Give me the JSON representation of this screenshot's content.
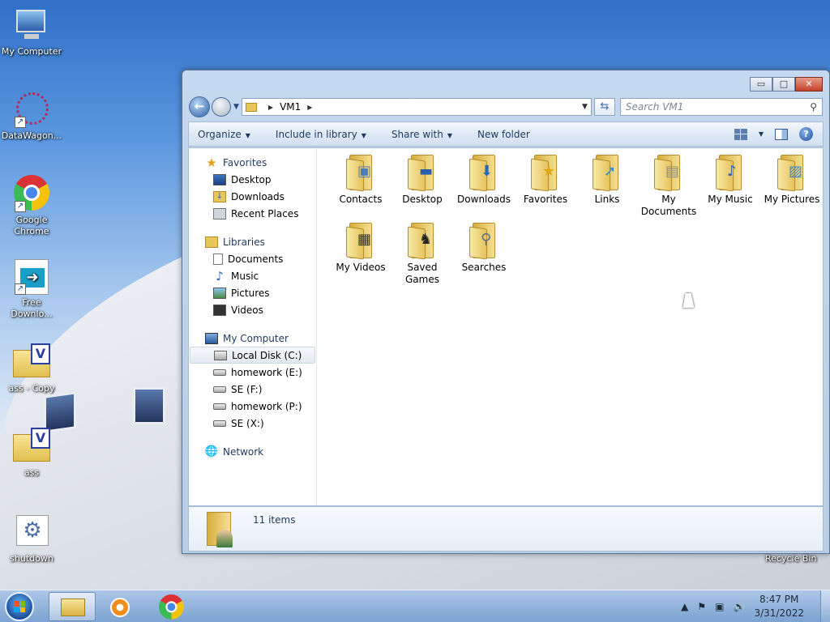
{
  "desktop": {
    "icons": [
      {
        "label": "My Computer"
      },
      {
        "label": "DataWagon..."
      },
      {
        "label": "Google Chrome"
      },
      {
        "label": "Free Downlo..."
      },
      {
        "label": "ass - Copy"
      },
      {
        "label": "ass"
      },
      {
        "label": "shutdown"
      }
    ],
    "recycle_label": "Recycle Bin"
  },
  "window": {
    "caption_buttons": {
      "minimize": "▭",
      "maximize": "□",
      "close": "✕"
    },
    "address": {
      "path_item": "VM1"
    },
    "search": {
      "placeholder": "Search VM1"
    },
    "toolbar": {
      "organize": "Organize",
      "include_in_library": "Include in library",
      "share_with": "Share with",
      "new_folder": "New folder"
    },
    "nav": {
      "favorites": {
        "label": "Favorites",
        "items": [
          "Desktop",
          "Downloads",
          "Recent Places"
        ]
      },
      "libraries": {
        "label": "Libraries",
        "items": [
          "Documents",
          "Music",
          "Pictures",
          "Videos"
        ]
      },
      "computer": {
        "label": "My Computer",
        "items": [
          "Local Disk (C:)",
          "homework (E:)",
          "SE (F:)",
          "homework (P:)",
          "SE (X:)"
        ]
      },
      "network": {
        "label": "Network"
      }
    },
    "files": [
      {
        "name": "Contacts",
        "icon": "contacts-icon"
      },
      {
        "name": "Desktop",
        "icon": "desktop-icon"
      },
      {
        "name": "Downloads",
        "icon": "downloads-icon"
      },
      {
        "name": "Favorites",
        "icon": "favorites-icon"
      },
      {
        "name": "Links",
        "icon": "links-icon"
      },
      {
        "name": "My Documents",
        "icon": "documents-icon"
      },
      {
        "name": "My Music",
        "icon": "music-icon"
      },
      {
        "name": "My Pictures",
        "icon": "pictures-icon"
      },
      {
        "name": "My Videos",
        "icon": "videos-icon"
      },
      {
        "name": "Saved Games",
        "icon": "games-icon"
      },
      {
        "name": "Searches",
        "icon": "searches-icon"
      }
    ],
    "details": {
      "count": "11 items"
    }
  },
  "taskbar": {
    "clock": {
      "time": "8:47 PM",
      "date": "3/31/2022"
    },
    "tray_icons": [
      "show-hidden-icons",
      "action-center-icon",
      "network-icon",
      "volume-icon"
    ]
  }
}
